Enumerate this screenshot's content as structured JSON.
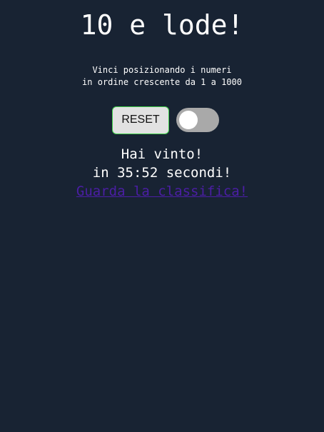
{
  "header": {
    "title": "10 e lode!"
  },
  "instructions": {
    "line1": "Vinci posizionando i numeri",
    "line2": "in ordine crescente da 1 a 1000"
  },
  "controls": {
    "reset_label": "RESET",
    "toggle_on": false
  },
  "result": {
    "win_text": "Hai vinto!",
    "time_prefix": "in ",
    "time_value": "35:52",
    "time_suffix": " secondi!",
    "leaderboard_link": "Guarda la classifica!"
  },
  "colors": {
    "background": "#182333",
    "link": "#4b1ea5",
    "reset_border": "#3fcf4a",
    "toggle_track": "#a9a9a9"
  }
}
